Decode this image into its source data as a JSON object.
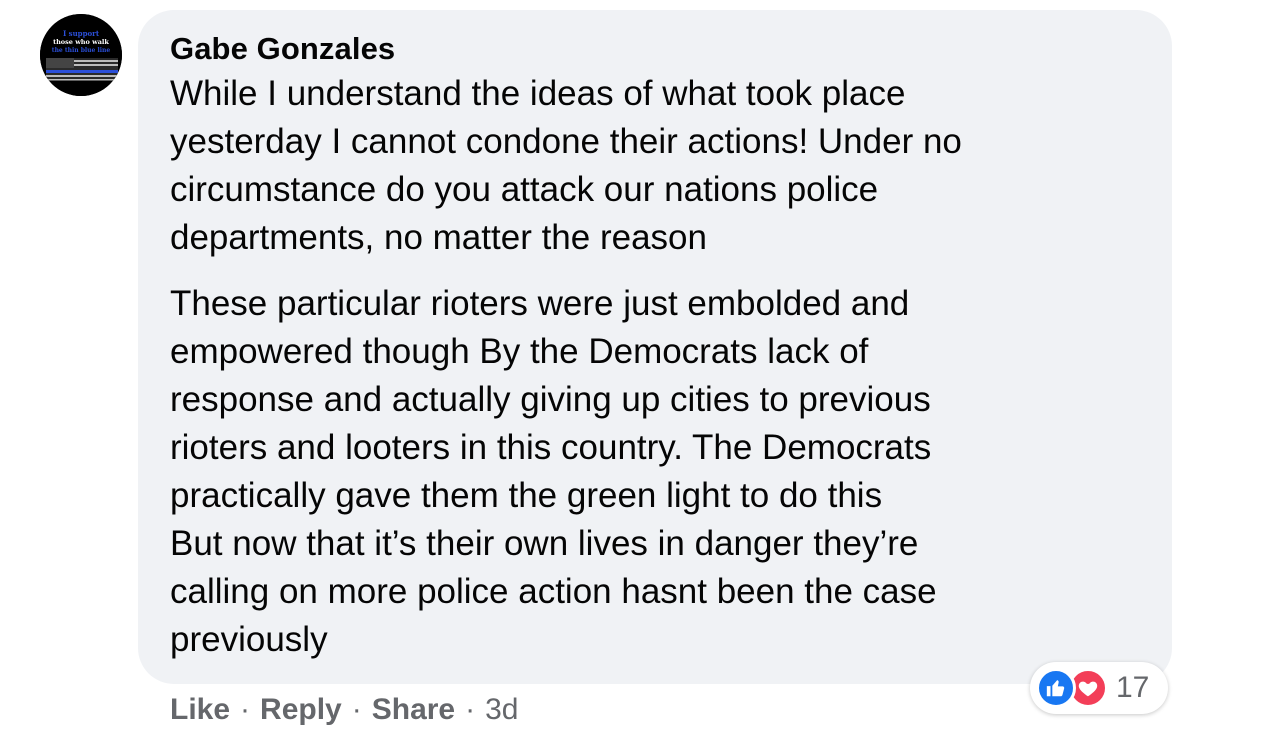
{
  "comment": {
    "author": "Gabe Gonzales",
    "avatar_text": [
      "I support",
      "those who walk",
      "the thin blue line"
    ],
    "paragraphs": [
      [
        "While I understand the ideas of what took place",
        "yesterday I cannot condone their actions! Under no",
        "circumstance do you attack our nations police",
        "departments, no matter the reason"
      ],
      [
        "These particular rioters were just embolded and",
        "empowered though By the Democrats lack of",
        "response and actually giving up cities to previous",
        "rioters and looters in this country. The Democrats",
        "practically gave them the green light to do this",
        "But now that it’s their own lives in danger they’re",
        "calling on more police action hasnt been the case",
        "previously"
      ]
    ]
  },
  "reactions": {
    "icons": [
      "like-icon",
      "love-icon"
    ],
    "count": "17",
    "colors": {
      "like": "#1877f2",
      "love": "#f33e58"
    }
  },
  "actions": {
    "like_label": "Like",
    "reply_label": "Reply",
    "share_label": "Share",
    "separator": "·",
    "timestamp": "3d"
  },
  "colors": {
    "bubble": "#f0f2f5",
    "text": "#050505",
    "secondary_text": "#65676b"
  }
}
